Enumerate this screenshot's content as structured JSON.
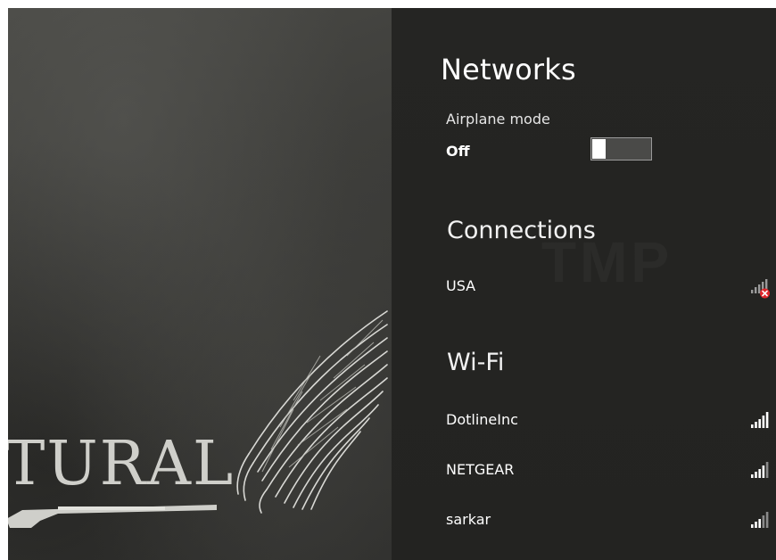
{
  "wallpaper": {
    "text": "TURAL"
  },
  "networks_panel": {
    "title": "Networks",
    "airplane_mode": {
      "label": "Airplane mode",
      "state": "Off",
      "enabled": false
    },
    "connections": {
      "heading": "Connections",
      "items": [
        {
          "name": "USA",
          "icon": "cellular-signal-disconnected-icon",
          "status": "error"
        }
      ]
    },
    "wifi": {
      "heading": "Wi-Fi",
      "items": [
        {
          "name": "DotlineInc",
          "icon": "wifi-signal-icon"
        },
        {
          "name": "NETGEAR",
          "icon": "wifi-signal-icon"
        },
        {
          "name": "sarkar",
          "icon": "wifi-signal-icon"
        }
      ]
    }
  },
  "colors": {
    "panel_background": "#252523",
    "text": "#ffffff",
    "error_badge": "#e0262b",
    "toggle_thumb": "#ffffff"
  }
}
